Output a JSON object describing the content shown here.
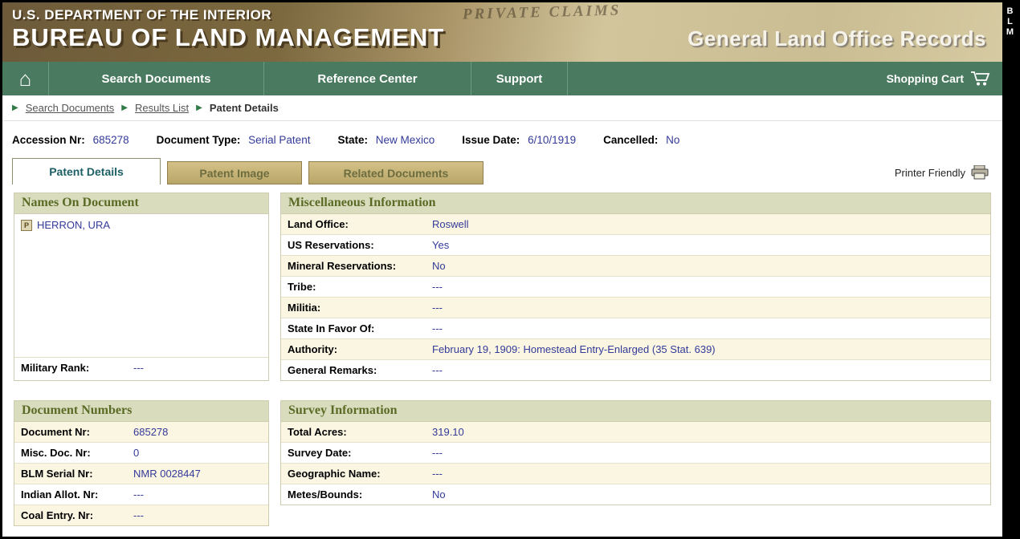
{
  "header": {
    "dept": "U.S. DEPARTMENT OF THE INTERIOR",
    "bureau": "BUREAU OF LAND MANAGEMENT",
    "records": "General Land Office Records",
    "watermark": "PRIVATE CLAIMS",
    "side_label": "BLM"
  },
  "icons": {
    "home_glyph": "⌂",
    "breadcrumb_arrow": "▶",
    "patentee_glyph": "P"
  },
  "colors": {
    "nav_green": "#4a7a5f",
    "panel_header_bg": "#d9dcbd",
    "panel_title_text": "#5a6b26",
    "value_blue": "#333a99",
    "tab_inactive_bg": "#c7b375",
    "tab_active_text": "#1d5f66",
    "masthead_brown": "#6d5a39",
    "masthead_parchment": "#d2c59c"
  },
  "nav": {
    "items": [
      {
        "label": "Search Documents"
      },
      {
        "label": "Reference Center"
      },
      {
        "label": "Support"
      }
    ],
    "cart_label": "Shopping Cart"
  },
  "breadcrumb": {
    "items": [
      {
        "label": "Search Documents"
      },
      {
        "label": "Results List"
      },
      {
        "label": "Patent Details"
      }
    ]
  },
  "summary": {
    "fields": [
      {
        "label": "Accession Nr:",
        "value": "685278"
      },
      {
        "label": "Document Type:",
        "value": "Serial Patent"
      },
      {
        "label": "State:",
        "value": "New Mexico"
      },
      {
        "label": "Issue Date:",
        "value": "6/10/1919"
      },
      {
        "label": "Cancelled:",
        "value": "No"
      }
    ]
  },
  "tabs": {
    "items": [
      {
        "label": "Patent Details",
        "active": true
      },
      {
        "label": "Patent Image",
        "active": false
      },
      {
        "label": "Related Documents",
        "active": false
      }
    ],
    "printer_friendly_label": "Printer Friendly"
  },
  "panels": {
    "names": {
      "title": "Names On Document",
      "patentees": [
        {
          "name": "HERRON, URA"
        }
      ],
      "footer": {
        "label": "Military Rank:",
        "value": "---"
      }
    },
    "misc": {
      "title": "Miscellaneous Information",
      "rows": [
        {
          "label": "Land Office:",
          "value": "Roswell"
        },
        {
          "label": "US Reservations:",
          "value": "Yes"
        },
        {
          "label": "Mineral Reservations:",
          "value": "No"
        },
        {
          "label": "Tribe:",
          "value": "---"
        },
        {
          "label": "Militia:",
          "value": "---"
        },
        {
          "label": "State In Favor Of:",
          "value": "---"
        },
        {
          "label": "Authority:",
          "value": "February 19, 1909: Homestead Entry-Enlarged (35 Stat. 639)"
        },
        {
          "label": "General Remarks:",
          "value": "---"
        }
      ]
    },
    "docnums": {
      "title": "Document Numbers",
      "rows": [
        {
          "label": "Document Nr:",
          "value": "685278"
        },
        {
          "label": "Misc. Doc. Nr:",
          "value": "0"
        },
        {
          "label": "BLM Serial Nr:",
          "value": "NMR 0028447"
        },
        {
          "label": "Indian Allot. Nr:",
          "value": "---"
        },
        {
          "label": "Coal Entry. Nr:",
          "value": "---"
        }
      ]
    },
    "survey": {
      "title": "Survey Information",
      "rows": [
        {
          "label": "Total Acres:",
          "value": "319.10"
        },
        {
          "label": "Survey Date:",
          "value": "---"
        },
        {
          "label": "Geographic Name:",
          "value": "---"
        },
        {
          "label": "Metes/Bounds:",
          "value": "No"
        }
      ]
    }
  }
}
